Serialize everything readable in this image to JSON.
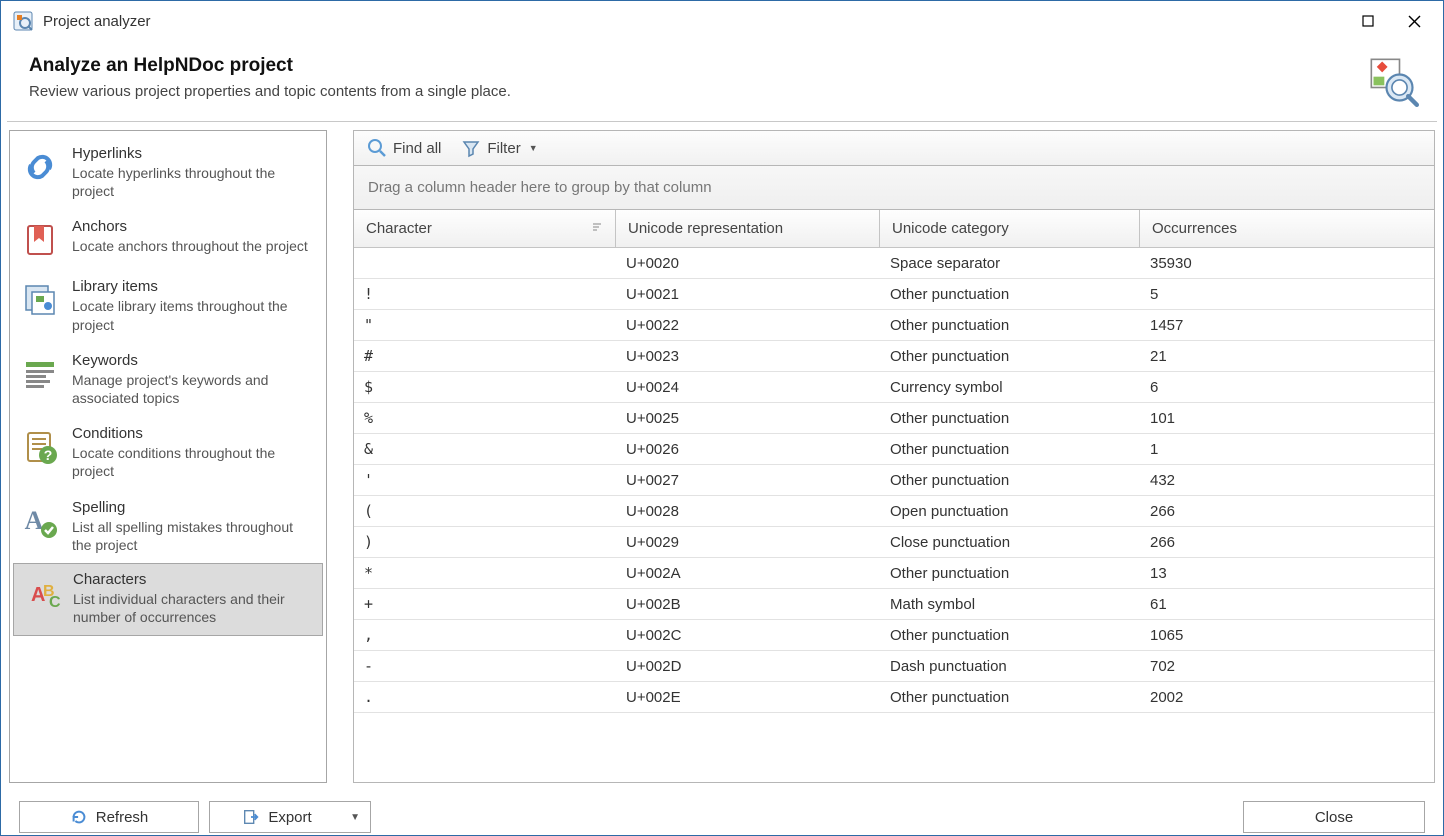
{
  "window": {
    "title": "Project analyzer",
    "header_title": "Analyze an HelpNDoc project",
    "header_subtitle": "Review various project properties and topic contents from a single place."
  },
  "sidebar": {
    "items": [
      {
        "title": "Hyperlinks",
        "desc": "Locate hyperlinks throughout the project",
        "selected": false
      },
      {
        "title": "Anchors",
        "desc": "Locate anchors throughout the project",
        "selected": false
      },
      {
        "title": "Library items",
        "desc": "Locate library items throughout the project",
        "selected": false
      },
      {
        "title": "Keywords",
        "desc": "Manage project's keywords and associated topics",
        "selected": false
      },
      {
        "title": "Conditions",
        "desc": "Locate conditions throughout the project",
        "selected": false
      },
      {
        "title": "Spelling",
        "desc": "List all spelling mistakes throughout the project",
        "selected": false
      },
      {
        "title": "Characters",
        "desc": "List individual characters and their number of occurrences",
        "selected": true
      }
    ]
  },
  "toolbar": {
    "find_all": "Find all",
    "filter": "Filter"
  },
  "grid": {
    "group_hint": "Drag a column header here to group by that column",
    "columns": [
      "Character",
      "Unicode representation",
      "Unicode category",
      "Occurrences"
    ],
    "rows": [
      {
        "char": " ",
        "code": "U+0020",
        "cat": "Space separator",
        "occ": "35930"
      },
      {
        "char": "!",
        "code": "U+0021",
        "cat": "Other punctuation",
        "occ": "5"
      },
      {
        "char": "\"",
        "code": "U+0022",
        "cat": "Other punctuation",
        "occ": "1457"
      },
      {
        "char": "#",
        "code": "U+0023",
        "cat": "Other punctuation",
        "occ": "21"
      },
      {
        "char": "$",
        "code": "U+0024",
        "cat": "Currency symbol",
        "occ": "6"
      },
      {
        "char": "%",
        "code": "U+0025",
        "cat": "Other punctuation",
        "occ": "101"
      },
      {
        "char": "&",
        "code": "U+0026",
        "cat": "Other punctuation",
        "occ": "1"
      },
      {
        "char": "'",
        "code": "U+0027",
        "cat": "Other punctuation",
        "occ": "432"
      },
      {
        "char": "(",
        "code": "U+0028",
        "cat": "Open punctuation",
        "occ": "266"
      },
      {
        "char": ")",
        "code": "U+0029",
        "cat": "Close punctuation",
        "occ": "266"
      },
      {
        "char": "*",
        "code": "U+002A",
        "cat": "Other punctuation",
        "occ": "13"
      },
      {
        "char": "+",
        "code": "U+002B",
        "cat": "Math symbol",
        "occ": "61"
      },
      {
        "char": ",",
        "code": "U+002C",
        "cat": "Other punctuation",
        "occ": "1065"
      },
      {
        "char": "-",
        "code": "U+002D",
        "cat": "Dash punctuation",
        "occ": "702"
      },
      {
        "char": ".",
        "code": "U+002E",
        "cat": "Other punctuation",
        "occ": "2002"
      }
    ]
  },
  "footer": {
    "refresh": "Refresh",
    "export": "Export",
    "close": "Close"
  }
}
